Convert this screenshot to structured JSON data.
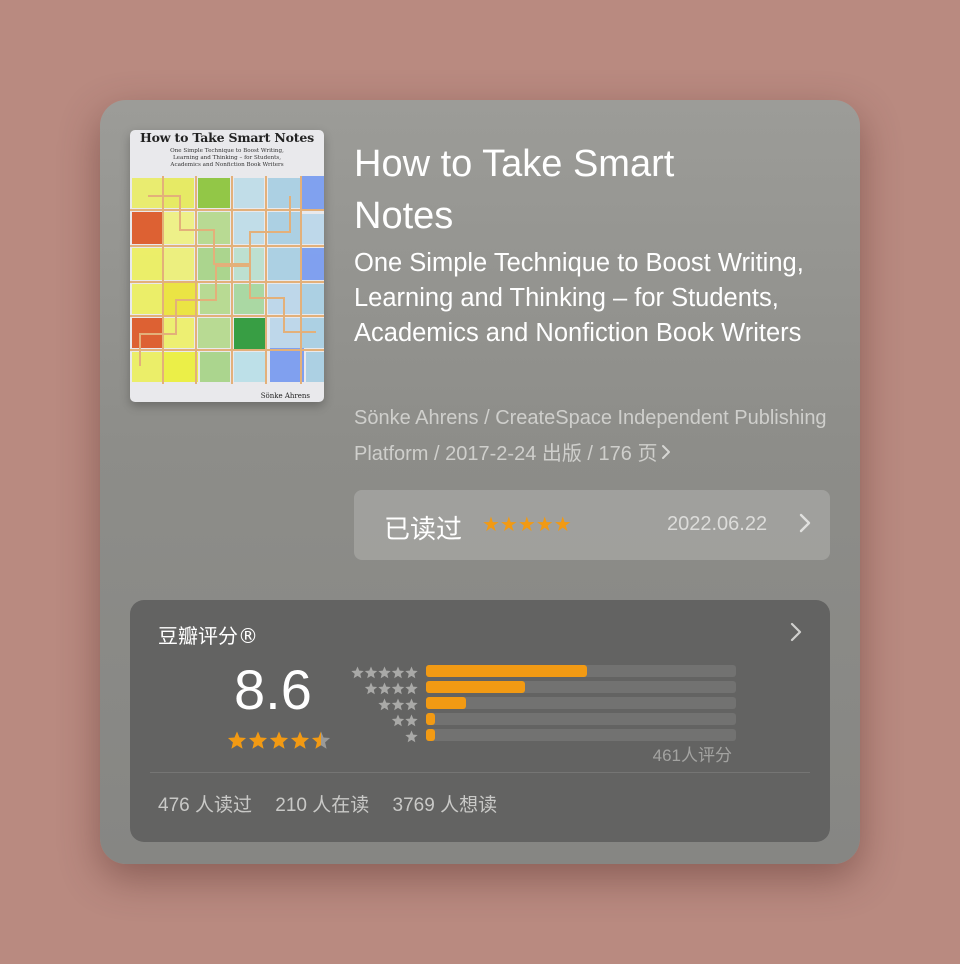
{
  "book": {
    "cover": {
      "title": "How to Take Smart Notes",
      "subtitle": "One Simple Technique to Boost Writing,\nLearning and Thinking – for Students,\nAcademics and Nonfiction Book Writers",
      "author": "Sönke Ahrens"
    },
    "title": "How to Take Smart Notes",
    "subtitle": "One Simple Technique to Boost Writing, Learning and Thinking – for Students, Academics and Nonfiction Book Writers",
    "meta": "Sönke Ahrens / CreateSpace Independent Publishing Platform / 2017-2-24 出版 / 176 页"
  },
  "read_status": {
    "label": "已读过",
    "stars": "★★★★★",
    "my_rating": 5,
    "date": "2022.06.22"
  },
  "rating": {
    "title": "豆瓣评分®",
    "score": "8.6",
    "star_value": 4.5,
    "distribution": [
      {
        "stars": 5,
        "fraction": 0.52
      },
      {
        "stars": 4,
        "fraction": 0.32
      },
      {
        "stars": 3,
        "fraction": 0.13
      },
      {
        "stars": 2,
        "fraction": 0.03
      },
      {
        "stars": 1,
        "fraction": 0.03
      }
    ],
    "count_text": "461人评分",
    "stats": [
      "476 人读过",
      "210 人在读",
      "3769 人想读"
    ]
  },
  "colors": {
    "accent": "#f29a13",
    "background": "#b98a80",
    "panel": "#636362"
  },
  "icons": {
    "meta_chevron": "chevron-right-icon",
    "read_chevron": "chevron-right-icon",
    "panel_chevron": "chevron-right-icon"
  }
}
